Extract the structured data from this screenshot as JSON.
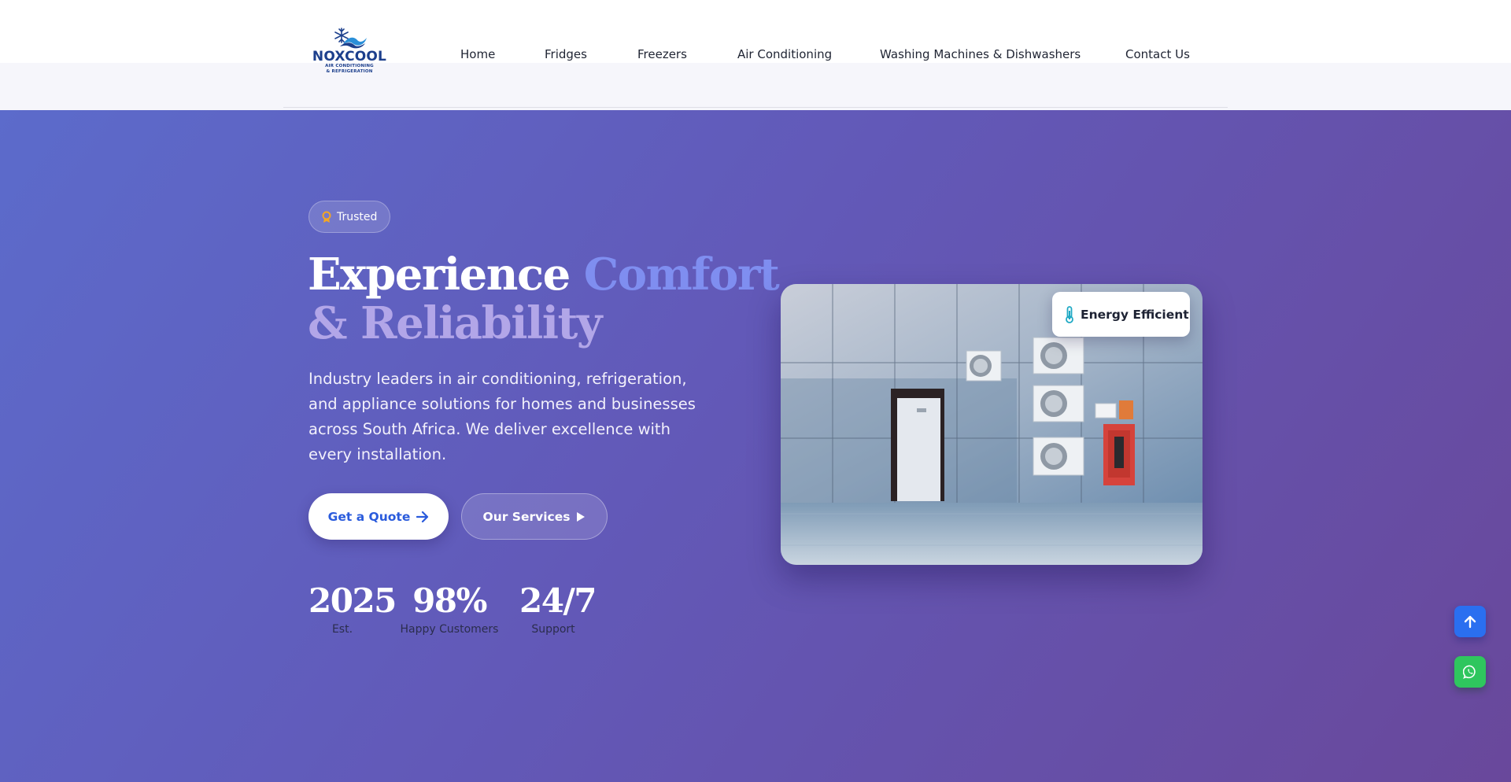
{
  "brand": {
    "name": "NOXCOOL",
    "tagline_1": "AIR CONDITIONING",
    "tagline_2": "& REFRIGERATION"
  },
  "nav": {
    "items": [
      {
        "label": "Home"
      },
      {
        "label": "Fridges"
      },
      {
        "label": "Freezers"
      },
      {
        "label": "Air Conditioning"
      },
      {
        "label": "Washing Machines & Dishwashers"
      },
      {
        "label": "Contact Us"
      }
    ]
  },
  "hero": {
    "badge": {
      "icon": "award-icon",
      "label": "Trusted"
    },
    "headline": {
      "part1": "Experience ",
      "part2": "Comfort",
      "part3": "& Reliability"
    },
    "description": "Industry leaders in air conditioning, refrigeration, and appliance solutions for homes and businesses across South Africa. We deliver excellence with every installation.",
    "cta_primary": {
      "label": "Get a Quote",
      "icon": "arrow-right-icon"
    },
    "cta_secondary": {
      "label": "Our Services",
      "icon": "play-icon"
    },
    "stats": [
      {
        "value": "2025",
        "label": "Est."
      },
      {
        "value": "98%",
        "label": "Happy Customers"
      },
      {
        "value": "24/7",
        "label": "Support"
      }
    ],
    "image_badge": {
      "icon": "thermometer-icon",
      "label": "Energy Efficient"
    }
  },
  "floating": {
    "scroll_top_icon": "arrow-up-icon",
    "whatsapp_icon": "whatsapp-icon"
  },
  "colors": {
    "gradient_start": "#5c6bcb",
    "gradient_end": "#69489b",
    "accent_blue": "#2a5bdc",
    "whatsapp_green": "#2fc65e",
    "headline_accent": "#7f8ef0",
    "headline_accent_2": "#b2a6e8"
  }
}
